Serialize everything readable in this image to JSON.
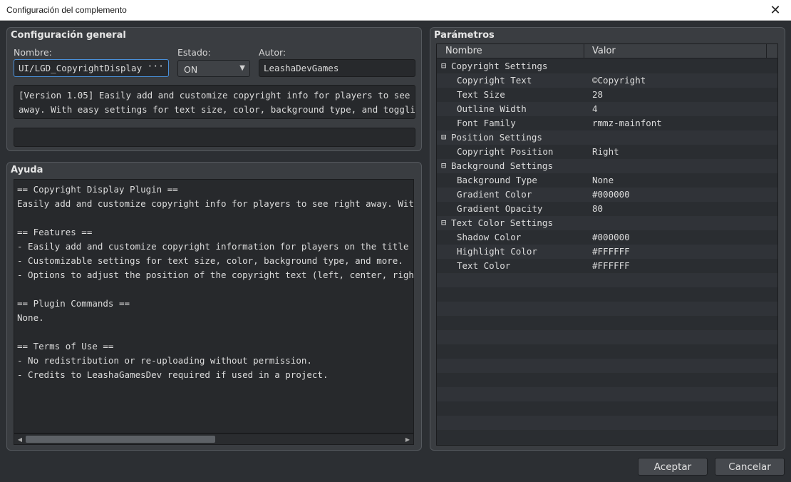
{
  "window": {
    "title": "Configuración del complemento",
    "close_glyph": "✕"
  },
  "general": {
    "title": "Configuración general",
    "name_label": "Nombre:",
    "name_value": "UI/LGD_CopyrightDisplay",
    "name_button": "···",
    "status_label": "Estado:",
    "status_value": "ON",
    "author_label": "Autor:",
    "author_value": "LeashaDevGames",
    "description_lines": [
      "[Version 1.05] Easily add and customize copyright info for players to see right",
      "away. With easy settings for text size, color, background type, and toggling"
    ]
  },
  "help": {
    "title": "Ayuda",
    "lines": [
      "== Copyright Display Plugin ==",
      "Easily add and customize copyright info for players to see right away. With eas",
      "",
      "== Features ==",
      "- Easily add and customize copyright information for players on the title scree",
      "- Customizable settings for text size, color, background type, and more.",
      "- Options to adjust the position of the copyright text (left, center, right).",
      "",
      "== Plugin Commands ==",
      "None.",
      "",
      "== Terms of Use ==",
      "- No redistribution or re-uploading without permission.",
      "- Credits to LeashaGamesDev required if used in a project."
    ]
  },
  "params": {
    "title": "Parámetros",
    "col_name": "Nombre",
    "col_value": "Valor",
    "rows": [
      {
        "group": true,
        "name": "Copyright Settings",
        "value": ""
      },
      {
        "group": false,
        "name": "Copyright Text",
        "value": "©Copyright"
      },
      {
        "group": false,
        "name": "Text Size",
        "value": "28"
      },
      {
        "group": false,
        "name": "Outline Width",
        "value": "4"
      },
      {
        "group": false,
        "name": "Font Family",
        "value": "rmmz-mainfont"
      },
      {
        "group": true,
        "name": "Position Settings",
        "value": ""
      },
      {
        "group": false,
        "name": "Copyright Position",
        "value": "Right"
      },
      {
        "group": true,
        "name": "Background Settings",
        "value": ""
      },
      {
        "group": false,
        "name": "Background Type",
        "value": "None"
      },
      {
        "group": false,
        "name": "Gradient Color",
        "value": "#000000"
      },
      {
        "group": false,
        "name": "Gradient Opacity",
        "value": "80"
      },
      {
        "group": true,
        "name": "Text Color Settings",
        "value": ""
      },
      {
        "group": false,
        "name": "Shadow Color",
        "value": "#000000"
      },
      {
        "group": false,
        "name": "Highlight Color",
        "value": "#FFFFFF"
      },
      {
        "group": false,
        "name": "Text Color",
        "value": "#FFFFFF"
      }
    ]
  },
  "footer": {
    "accept_label": "Aceptar",
    "cancel_label": "Cancelar"
  }
}
